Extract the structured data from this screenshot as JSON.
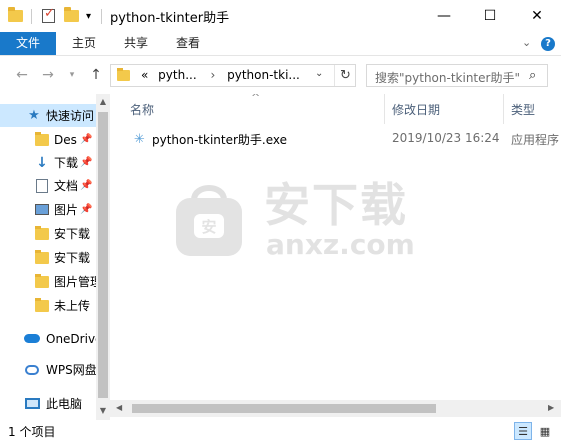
{
  "window": {
    "title": "python-tkinter助手",
    "minimize": "—",
    "maximize": "☐",
    "close": "✕"
  },
  "ribbon": {
    "tabs": [
      {
        "label": "文件"
      },
      {
        "label": "主页"
      },
      {
        "label": "共享"
      },
      {
        "label": "查看"
      }
    ],
    "help": "?"
  },
  "nav": {
    "crumbs": [
      "«",
      "pyth...",
      "›",
      "python-tki..."
    ],
    "search_placeholder": "搜索\"python-tkinter助手\""
  },
  "sidebar": {
    "items": [
      {
        "label": "快速访问",
        "icon": "star-icon",
        "selected": true,
        "pinned": false
      },
      {
        "label": "Des",
        "icon": "folder-icon",
        "pinned": true
      },
      {
        "label": "下载",
        "icon": "download-icon",
        "pinned": true
      },
      {
        "label": "文档",
        "icon": "document-icon",
        "pinned": true
      },
      {
        "label": "图片",
        "icon": "picture-icon",
        "pinned": true
      },
      {
        "label": "安下载",
        "icon": "folder-icon",
        "pinned": false
      },
      {
        "label": "安下载",
        "icon": "folder-icon",
        "pinned": false
      },
      {
        "label": "图片管理",
        "icon": "folder-icon",
        "pinned": false
      },
      {
        "label": "未上传",
        "icon": "folder-icon",
        "pinned": false
      },
      {
        "label": "OneDrive",
        "icon": "onedrive-icon",
        "pinned": false
      },
      {
        "label": "WPS网盘",
        "icon": "wps-cloud-icon",
        "pinned": false
      },
      {
        "label": "此电脑",
        "icon": "this-pc-icon",
        "pinned": false
      }
    ]
  },
  "columns": [
    {
      "label": "名称"
    },
    {
      "label": "修改日期"
    },
    {
      "label": "类型"
    }
  ],
  "files": [
    {
      "name": "python-tkinter助手.exe",
      "modified": "2019/10/23 16:24",
      "type": "应用程序"
    }
  ],
  "watermark": {
    "line1": "安下载",
    "line2": "anxz.com"
  },
  "status": {
    "text": "1 个项目"
  },
  "colors": {
    "accent": "#1979ca",
    "selection": "#cce8ff",
    "folder": "#f3c94b"
  }
}
